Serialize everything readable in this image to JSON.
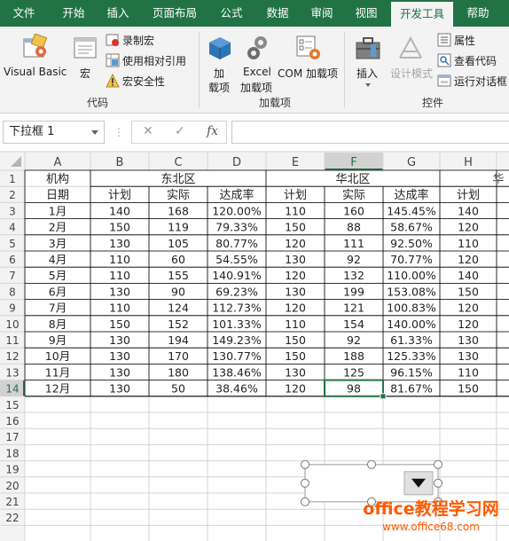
{
  "tabs": [
    {
      "label": "文件",
      "active": false
    },
    {
      "label": "开始",
      "active": false
    },
    {
      "label": "插入",
      "active": false
    },
    {
      "label": "页面布局",
      "active": false
    },
    {
      "label": "公式",
      "active": false
    },
    {
      "label": "数据",
      "active": false
    },
    {
      "label": "审阅",
      "active": false
    },
    {
      "label": "视图",
      "active": false
    },
    {
      "label": "开发工具",
      "active": true
    },
    {
      "label": "帮助",
      "active": false
    }
  ],
  "ribbon": {
    "code": {
      "visual_basic": "Visual Basic",
      "macros": "宏",
      "record_macro": "录制宏",
      "relative_ref": "使用相对引用",
      "macro_security": "宏安全性",
      "group_label": "代码"
    },
    "addins": {
      "addins_line1": "加",
      "addins_line2": "载项",
      "excel_line1": "Excel",
      "excel_line2": "加载项",
      "com_line1": "COM 加载项",
      "group_label": "加载项"
    },
    "controls": {
      "insert": "插入",
      "design_mode": "设计模式",
      "properties": "属性",
      "view_code": "查看代码",
      "run_dialog": "运行对话框",
      "group_label": "控件"
    }
  },
  "formula_bar": {
    "name_box": "下拉框 1",
    "cancel": "✕",
    "enter": "✓",
    "fx": "fx",
    "value": ""
  },
  "sheet": {
    "columns": [
      "A",
      "B",
      "C",
      "D",
      "E",
      "F",
      "G",
      "H"
    ],
    "selected_column": "F",
    "row_numbers": [
      "1",
      "2",
      "3",
      "4",
      "5",
      "6",
      "7",
      "8",
      "9",
      "10",
      "11",
      "12",
      "13",
      "14",
      "15",
      "16",
      "17",
      "18",
      "19",
      "20",
      "21",
      "22"
    ],
    "selected_row": "14",
    "header_row1": {
      "a": "机构",
      "region1": "东北区",
      "region2": "华北区",
      "region3_partial": "华"
    },
    "header_row2": [
      "日期",
      "计划",
      "实际",
      "达成率",
      "计划",
      "实际",
      "达成率",
      "计划"
    ],
    "rows": [
      [
        "1月",
        "140",
        "168",
        "120.00%",
        "110",
        "160",
        "145.45%",
        "140"
      ],
      [
        "2月",
        "150",
        "119",
        "79.33%",
        "150",
        "88",
        "58.67%",
        "120"
      ],
      [
        "3月",
        "130",
        "105",
        "80.77%",
        "120",
        "111",
        "92.50%",
        "110"
      ],
      [
        "4月",
        "110",
        "60",
        "54.55%",
        "130",
        "92",
        "70.77%",
        "120"
      ],
      [
        "5月",
        "110",
        "155",
        "140.91%",
        "120",
        "132",
        "110.00%",
        "140"
      ],
      [
        "6月",
        "130",
        "90",
        "69.23%",
        "130",
        "199",
        "153.08%",
        "150"
      ],
      [
        "7月",
        "110",
        "124",
        "112.73%",
        "120",
        "121",
        "100.83%",
        "120"
      ],
      [
        "8月",
        "150",
        "152",
        "101.33%",
        "110",
        "154",
        "140.00%",
        "120"
      ],
      [
        "9月",
        "130",
        "194",
        "149.23%",
        "150",
        "92",
        "61.33%",
        "130"
      ],
      [
        "10月",
        "130",
        "170",
        "130.77%",
        "150",
        "188",
        "125.33%",
        "130"
      ],
      [
        "11月",
        "130",
        "180",
        "138.46%",
        "130",
        "125",
        "96.15%",
        "110"
      ],
      [
        "12月",
        "130",
        "50",
        "38.46%",
        "120",
        "98",
        "81.67%",
        "150"
      ]
    ]
  },
  "watermark": {
    "line1": "office教程学习网",
    "line2": "www.office68.com"
  },
  "colors": {
    "accent": "#217346",
    "ribbon_bg": "#f3f3f3",
    "gridline": "#d4d4d4",
    "header_bg": "#f3f3f3",
    "watermark": "#ff5a00"
  }
}
